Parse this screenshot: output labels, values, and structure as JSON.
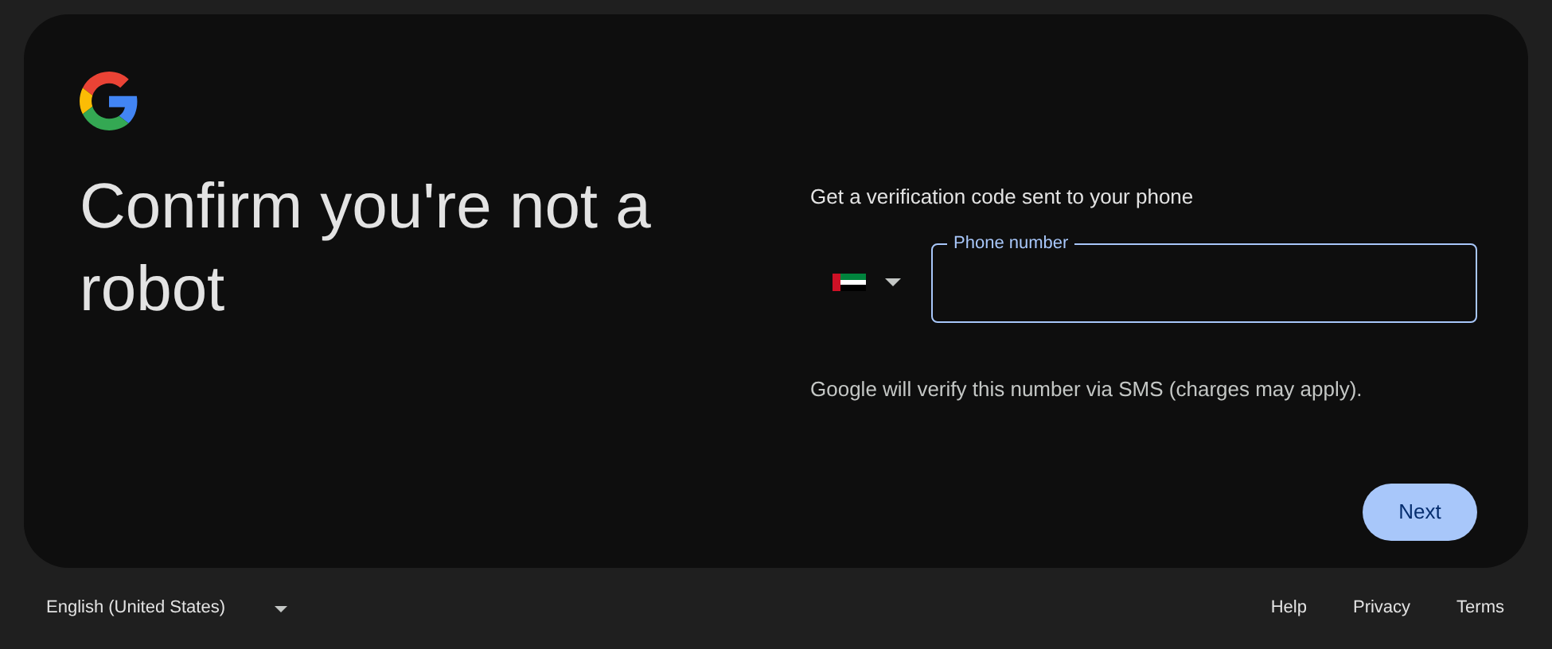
{
  "card": {
    "title": "Confirm you're not a robot",
    "prompt": "Get a verification code sent to your phone",
    "phone_field": {
      "label": "Phone number",
      "focused": true
    },
    "helper": "Google will verify this number via SMS (charges may apply).",
    "next_button": "Next"
  },
  "footer": {
    "language": "English (United States)",
    "links": [
      "Help",
      "Privacy",
      "Terms"
    ]
  }
}
